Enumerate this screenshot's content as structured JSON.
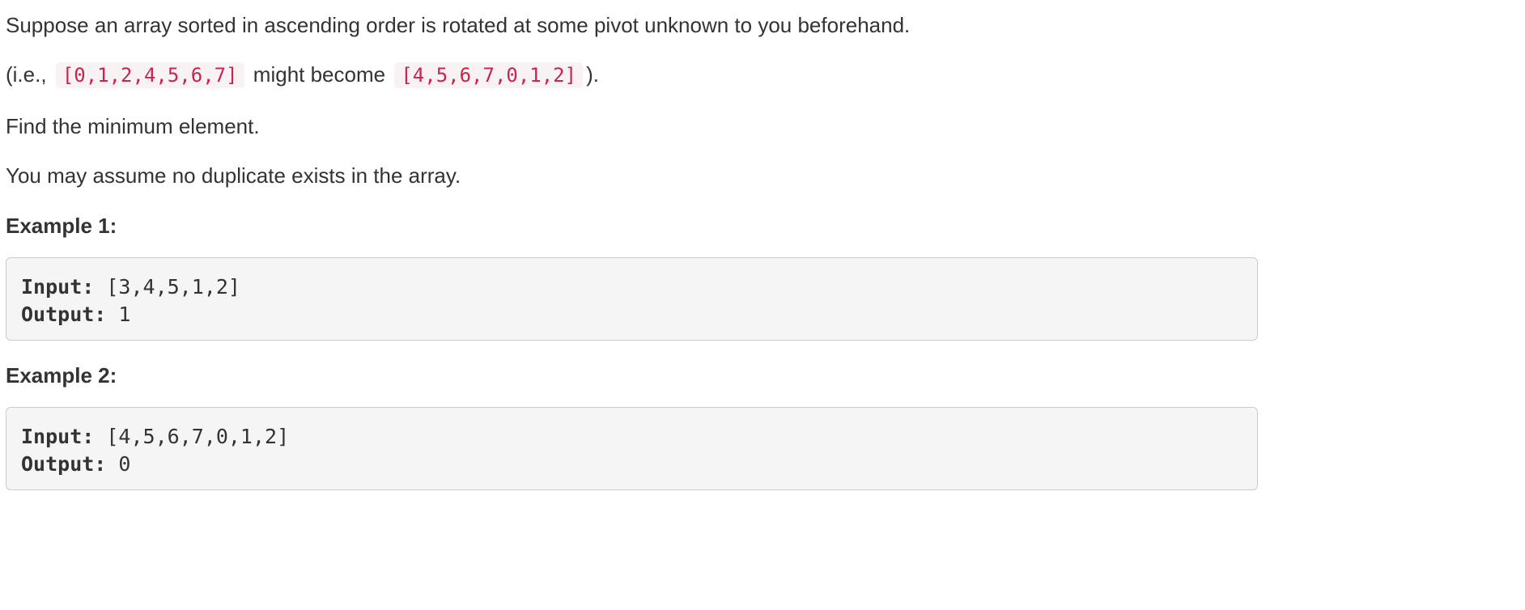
{
  "description": {
    "para1": "Suppose an array sorted in ascending order is rotated at some pivot unknown to you beforehand.",
    "para2": {
      "prefix": "(i.e.,",
      "code_a": "[0,1,2,4,5,6,7]",
      "middle": "might become",
      "code_b": "[4,5,6,7,0,1,2]",
      "suffix": ")."
    },
    "para3": "Find the minimum element.",
    "para4": "You may assume no duplicate exists in the array."
  },
  "examples": [
    {
      "heading": "Example 1:",
      "input_label": "Input:",
      "input_value": " [3,4,5,1,2]",
      "output_label": "Output:",
      "output_value": " 1"
    },
    {
      "heading": "Example 2:",
      "input_label": "Input:",
      "input_value": " [4,5,6,7,0,1,2]",
      "output_label": "Output:",
      "output_value": " 0"
    }
  ],
  "colors": {
    "text": "#333333",
    "inline_code_text": "#c7254e",
    "inline_code_bg": "#f9f2f4",
    "pre_bg": "#f5f5f5",
    "pre_border": "#cccccc"
  }
}
